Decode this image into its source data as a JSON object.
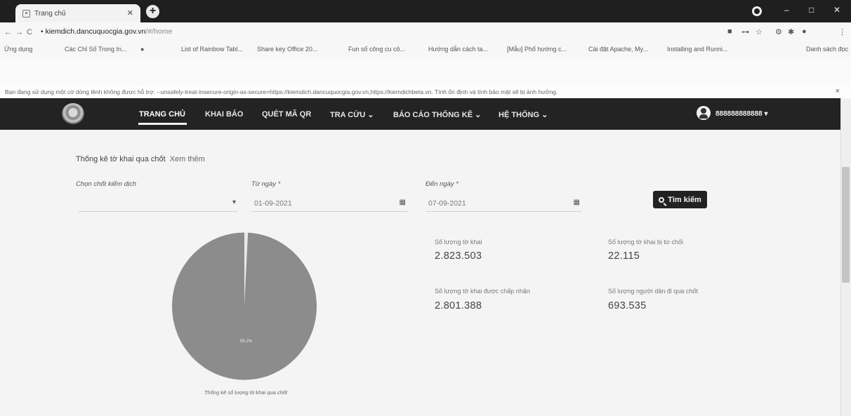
{
  "browser": {
    "tab_title": "Trang chủ",
    "url_host": "kiemdich.dancuquocgia.gov.vn",
    "url_path": "/#/home",
    "bookmarks": [
      "Ứng dụng",
      "Các Chỉ Số Trong In...",
      "",
      "List of Rainbow Tabl...",
      "Share key Office 20...",
      "Fun số công cu cô...",
      "Hướng dẫn cách ta...",
      "[Mẫu] Phổ hướng c...",
      "Cài đặt Apache, My...",
      "Installing and Runni...",
      "Danh sách đọc"
    ],
    "infobar_text": "Bạn đang sử dụng một cờ dòng lệnh không được hỗ trợ: --unsafely-treat-insecure-origin-as-secure=https://kiemdich.dancuquocgia.gov.vn,https://kiemdichbeta.vn. Tính ổn định và tính bảo mật sẽ bị ảnh hưởng."
  },
  "nav": {
    "items": [
      "TRANG CHỦ",
      "KHAI BÁO",
      "QUÉT MÃ QR",
      "TRA CỨU ⌄",
      "BÁO CÁO THỐNG KÊ ⌄",
      "HỆ THỐNG ⌄"
    ],
    "user": "888888888888 ▾"
  },
  "filter": {
    "section_title": "Thống kê tờ khai qua chốt",
    "section_more": "Xem thêm",
    "checkpoint_label": "Chọn chốt kiểm dịch",
    "from_label": "Từ ngày *",
    "from_value": "01-09-2021",
    "to_label": "Đến ngày *",
    "to_value": "07-09-2021",
    "search_label": "Tìm kiếm"
  },
  "stats": [
    {
      "label": "Số lượng tờ khai",
      "value": "2.823.503"
    },
    {
      "label": "Số lượng tờ khai bị từ chối",
      "value": "22.115"
    },
    {
      "label": "Số lượng tờ khai được chấp nhận",
      "value": "2.801.388"
    },
    {
      "label": "Số lượng người dân đi qua chốt",
      "value": "693.535"
    }
  ],
  "pie": {
    "slice_label": "99.2%",
    "caption": "Thống kê số lượng tờ khai qua chốt",
    "accepted_fraction": 0.992,
    "colors": {
      "main": "#8c8c8c",
      "minor": "#e8e8e8"
    }
  }
}
